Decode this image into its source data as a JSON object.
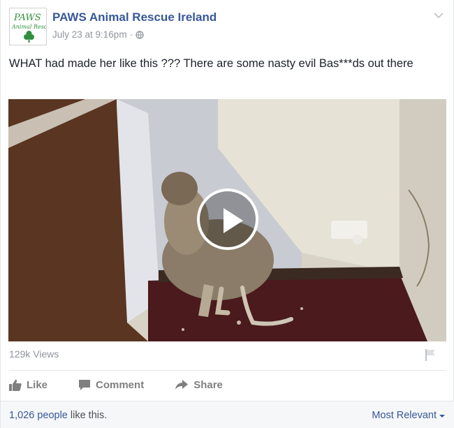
{
  "post": {
    "page_name": "PAWS Animal Rescue Ireland",
    "timestamp": "July 23 at 9:16pm",
    "separator": "·",
    "text": "WHAT had made her like this ??? There are some nasty evil Bas***ds out there",
    "avatar_text_line1": "PAWS",
    "avatar_text_line2": "Animal Rescue"
  },
  "video": {
    "views": "129k Views"
  },
  "actions": {
    "like": "Like",
    "comment": "Comment",
    "share": "Share"
  },
  "footer": {
    "likes_count": "1,026 people",
    "likes_suffix": " like this.",
    "sort": "Most Relevant"
  },
  "colors": {
    "link": "#365899",
    "meta": "#90949c",
    "action": "#7f7f7f",
    "footer_bg": "#f6f7f9"
  }
}
